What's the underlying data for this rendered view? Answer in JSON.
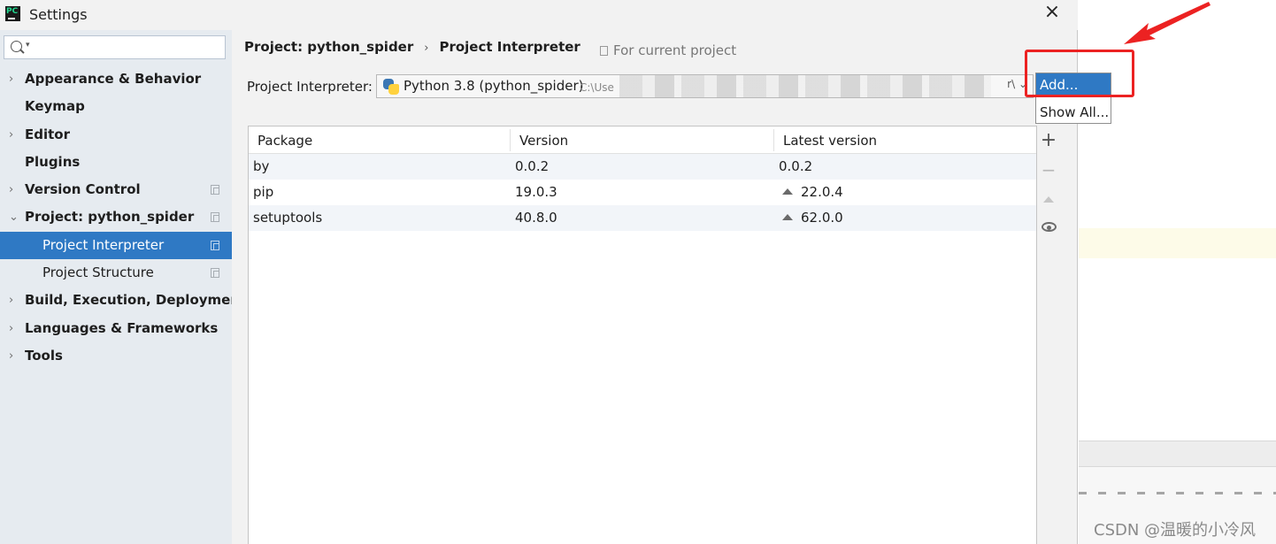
{
  "window": {
    "title": "Settings",
    "logo_text": "PC"
  },
  "sidebar": {
    "search": {
      "value": "",
      "placeholder": ""
    },
    "items": [
      {
        "label": "Appearance & Behavior",
        "arrow": "›"
      },
      {
        "label": "Keymap"
      },
      {
        "label": "Editor",
        "arrow": "›"
      },
      {
        "label": "Plugins"
      },
      {
        "label": "Version Control",
        "arrow": "›"
      },
      {
        "label": "Project: python_spider",
        "arrow": "⌄"
      },
      {
        "label": "Project Interpreter"
      },
      {
        "label": "Project Structure"
      },
      {
        "label": "Build, Execution, Deployment",
        "arrow": "›"
      },
      {
        "label": "Languages & Frameworks",
        "arrow": "›"
      },
      {
        "label": "Tools",
        "arrow": "›"
      }
    ]
  },
  "content": {
    "breadcrumb": {
      "parent": "Project: python_spider",
      "separator": "›",
      "current": "Project Interpreter"
    },
    "for_current_project": "For current project",
    "interpreter_label": "Project Interpreter:",
    "interpreter_value": "Python 3.8 (python_spider)",
    "interpreter_path": "C:\\Use",
    "interpreter_path_tail": "r\\",
    "dropdown": {
      "add_label": "Add...",
      "show_all_label": "Show All..."
    },
    "table": {
      "columns": [
        "Package",
        "Version",
        "Latest version"
      ],
      "rows": [
        {
          "package": "by",
          "version": "0.0.2",
          "latest": "0.0.2",
          "upgrade": false
        },
        {
          "package": "pip",
          "version": "19.0.3",
          "latest": "22.0.4",
          "upgrade": true
        },
        {
          "package": "setuptools",
          "version": "40.8.0",
          "latest": "62.0.0",
          "upgrade": true
        }
      ]
    },
    "tools": {
      "add": "+",
      "remove": "−"
    }
  },
  "watermark": "CSDN @温暖的小冷风",
  "colors": {
    "selection": "#2f79c4",
    "annotation": "#ec2222"
  },
  "icons": [
    "search-icon",
    "python-icon",
    "copy-icon",
    "eye-icon",
    "upgrade-icon",
    "close-icon"
  ]
}
